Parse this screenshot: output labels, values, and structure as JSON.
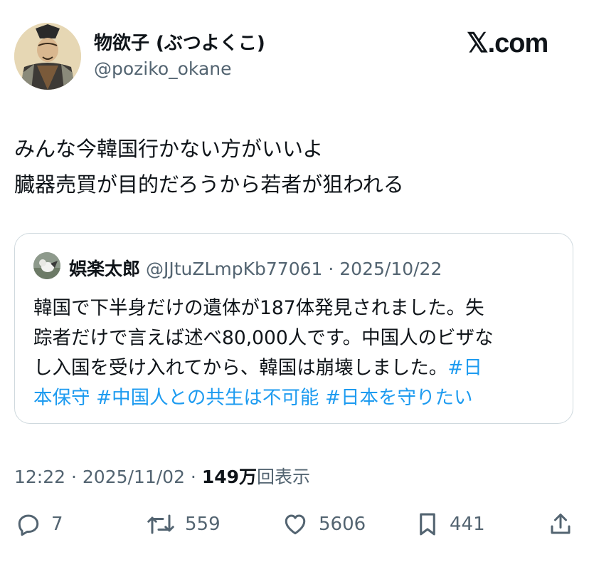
{
  "author": {
    "display_name": "物欲子 (ぶつよくこ)",
    "handle": "@poziko_okane",
    "avatar_icon": "samurai-portrait-avatar"
  },
  "brand": {
    "label": "𝕏.com"
  },
  "post": {
    "lines": [
      "みんな今韓国行かない方がいいよ",
      "臓器売買が目的だろうから若者が狙われる"
    ]
  },
  "quote": {
    "name": "娯楽太郎",
    "handle_date": "@JJtuZLmpKb77061 · 2025/10/22",
    "line1": "韓国で下半身だけの遺体が187体発見されました。失",
    "line2": "踪者だけで言えば述べ80,000人です。中国人のビザな",
    "line3_text": "し入国を受け入れてから、韓国は崩壊しました。",
    "line3_tag": "#日",
    "line4_tag1": "本保守",
    "line4_tag2": "#中国人との共生は不可能",
    "line4_tag3": "#日本を守りたい"
  },
  "meta": {
    "time_date": "12:22 · 2025/11/02 · ",
    "views_count": "149万",
    "views_label": "回表示"
  },
  "actions": {
    "reply_count": "7",
    "repost_count": "559",
    "like_count": "5606",
    "bookmark_count": "441"
  },
  "colors": {
    "text": "#0f1419",
    "secondary": "#536471",
    "hashtag": "#1d9bf0",
    "border": "#cfd9de"
  }
}
